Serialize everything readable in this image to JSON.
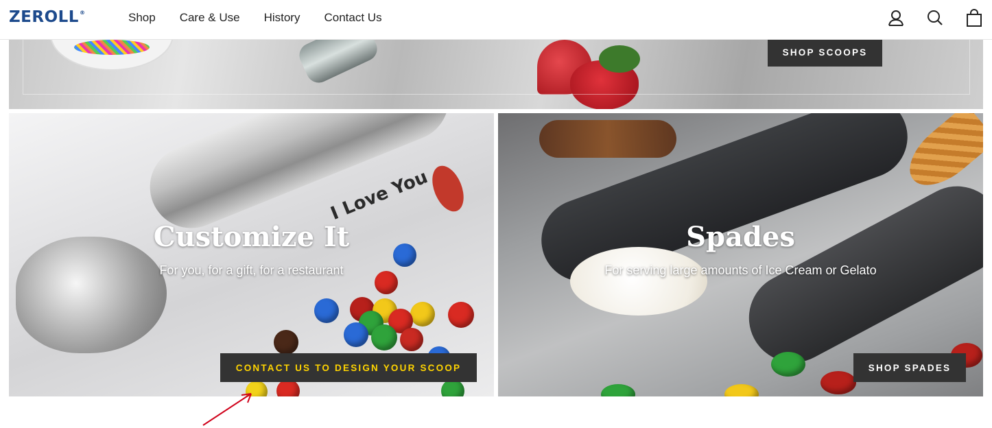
{
  "header": {
    "logo": "ZEROLL",
    "logo_mark": "®",
    "nav": [
      "Shop",
      "Care & Use",
      "History",
      "Contact Us"
    ],
    "icons": [
      "account-icon",
      "search-icon",
      "cart-icon"
    ]
  },
  "banner": {
    "button_label": "SHOP SCOOPS"
  },
  "panels": [
    {
      "title": "Customize It",
      "subtitle": "For you, for a gift, for a restaurant",
      "button_label": "CONTACT US TO DESIGN YOUR SCOOP",
      "engraving": "I Love You"
    },
    {
      "title": "Spades",
      "subtitle": "For serving large amounts of Ice Cream or Gelato",
      "button_label": "SHOP SPADES"
    }
  ],
  "colors": {
    "brand": "#1d4a8c",
    "button_bg": "#333333",
    "highlight_text": "#ffd400",
    "annotation_arrow": "#d0021b"
  }
}
